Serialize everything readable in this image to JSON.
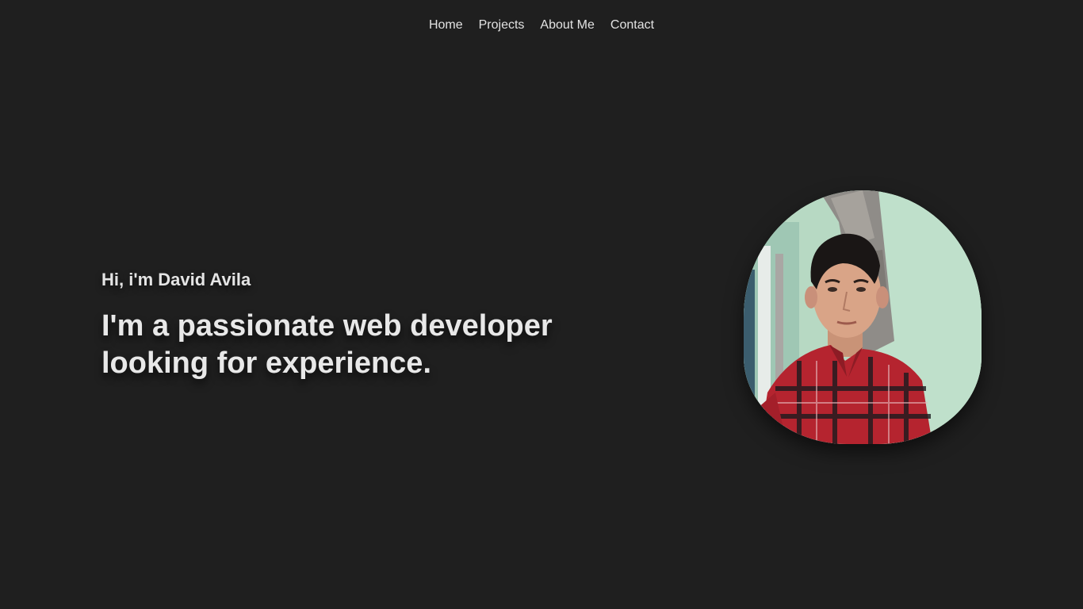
{
  "nav": {
    "items": [
      {
        "label": "Home"
      },
      {
        "label": "Projects"
      },
      {
        "label": "About Me"
      },
      {
        "label": "Contact"
      }
    ]
  },
  "hero": {
    "greeting": "Hi, i'm David Avila",
    "headline_line1": "I'm a passionate web developer",
    "headline_line2": "looking for experience."
  },
  "colors": {
    "background": "#1f1f1f",
    "text": "#e6e6e6"
  }
}
